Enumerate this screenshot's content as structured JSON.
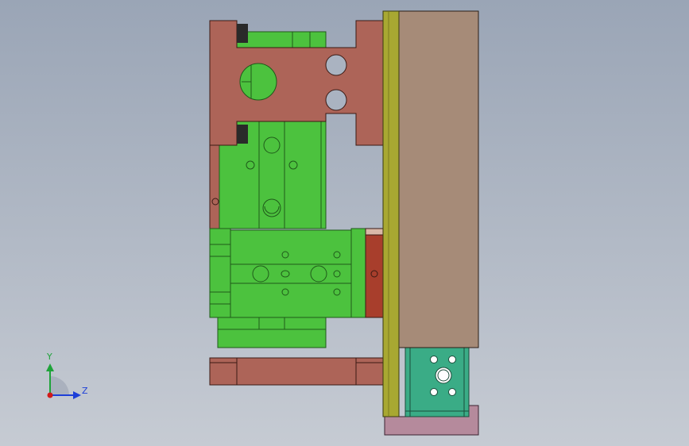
{
  "viewport": {
    "background_top": "#9aa5b6",
    "background_bottom": "#c6cbd3"
  },
  "colors": {
    "plate_red": "#ad6458",
    "plate_red_dark": "#a83e2c",
    "slide_green": "#4cc23e",
    "slide_green_dark": "#2e8a27",
    "guide_yellow": "#a8a832",
    "backplate_tan": "#a68b78",
    "block_teal": "#3aac86",
    "base_pink": "#b58a9c"
  },
  "triad": {
    "x_label": "",
    "y_label": "Y",
    "z_label": "Z",
    "y_color": "#1fa33a",
    "z_color": "#1d3fd8",
    "x_color": "#d21a1a"
  }
}
